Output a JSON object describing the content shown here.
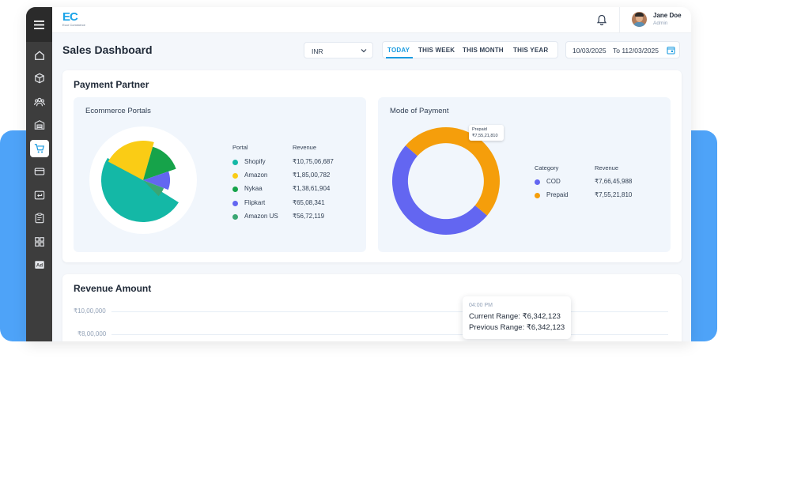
{
  "brand": {
    "logo_text": "EC",
    "logo_sub": "Ecor Commerce"
  },
  "header": {
    "user_name": "Jane Doe",
    "user_role": "Admin"
  },
  "page": {
    "title": "Sales Dashboard"
  },
  "filters": {
    "currency": "INR",
    "range_tabs": [
      "TODAY",
      "THIS WEEK",
      "THIS MONTH",
      "THIS YEAR"
    ],
    "active_tab": "TODAY",
    "date_from": "10/03/2025",
    "date_to": "To 112/03/2025"
  },
  "sidebar": {
    "items": [
      {
        "icon": "home-icon"
      },
      {
        "icon": "box-icon"
      },
      {
        "icon": "users-icon"
      },
      {
        "icon": "warehouse-icon"
      },
      {
        "icon": "cart-icon",
        "active": true
      },
      {
        "icon": "credit-card-icon"
      },
      {
        "icon": "return-icon"
      },
      {
        "icon": "clipboard-icon"
      },
      {
        "icon": "grid-icon"
      },
      {
        "icon": "ad-icon"
      }
    ]
  },
  "payment_partner": {
    "title": "Payment Partner",
    "ecommerce": {
      "title": "Ecommerce Portals",
      "col_portal": "Portal",
      "col_revenue": "Revenue",
      "rows": [
        {
          "label": "Shopify",
          "value": "₹10,75,06,687",
          "color": "#14b8a6"
        },
        {
          "label": "Amazon",
          "value": "₹1,85,00,782",
          "color": "#facc15"
        },
        {
          "label": "Nykaa",
          "value": "₹1,38,61,904",
          "color": "#16a34a"
        },
        {
          "label": "Flipkart",
          "value": "₹65,08,341",
          "color": "#6366f1"
        },
        {
          "label": "Amazon US",
          "value": "₹56,72,119",
          "color": "#3aa673"
        }
      ]
    },
    "mode": {
      "title": "Mode of Payment",
      "col_category": "Category",
      "col_revenue": "Revenue",
      "rows": [
        {
          "label": "COD",
          "value": "₹7,66,45,988",
          "color": "#6366f1"
        },
        {
          "label": "Prepaid",
          "value": "₹7,55,21,810",
          "color": "#f59e0b"
        }
      ],
      "tooltip": {
        "label": "Prepaid",
        "value": "₹7,55,21,810"
      }
    }
  },
  "revenue": {
    "title": "Revenue Amount",
    "y_ticks": [
      "₹10,00,000",
      "₹8,00,000"
    ],
    "tooltip": {
      "time": "04:00 PM",
      "current": "Current Range: ₹6,342,123",
      "previous": "Previous Range: ₹6,342,123"
    }
  },
  "chart_data": [
    {
      "type": "pie",
      "title": "Ecommerce Portals",
      "categories": [
        "Shopify",
        "Amazon",
        "Nykaa",
        "Flipkart",
        "Amazon US"
      ],
      "values": [
        107506687,
        18500782,
        13861904,
        6508341,
        5672119
      ],
      "colors": [
        "#14b8a6",
        "#facc15",
        "#16a34a",
        "#6366f1",
        "#3aa673"
      ]
    },
    {
      "type": "pie",
      "title": "Mode of Payment",
      "categories": [
        "COD",
        "Prepaid"
      ],
      "values": [
        76645988,
        75521810
      ],
      "colors": [
        "#6366f1",
        "#f59e0b"
      ]
    }
  ]
}
